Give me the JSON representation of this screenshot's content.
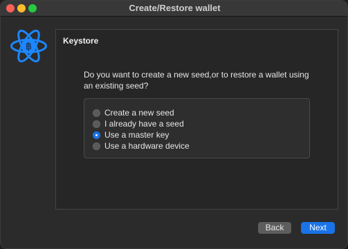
{
  "window": {
    "title": "Create/Restore wallet"
  },
  "colors": {
    "close": "#ff5f57",
    "minimize": "#febc2e",
    "zoom": "#28c840",
    "logo": "#1c87ff",
    "accent": "#1a73e8"
  },
  "logo": {
    "icon": "electrum-bitcoin-logo"
  },
  "panel": {
    "heading": "Keystore",
    "question": "Do you want to create a new seed,or to restore a wallet using an existing seed?",
    "options": [
      {
        "label": "Create a new seed",
        "checked": false
      },
      {
        "label": "I already have a seed",
        "checked": false
      },
      {
        "label": "Use a master key",
        "checked": true
      },
      {
        "label": "Use a hardware device",
        "checked": false
      }
    ]
  },
  "buttons": {
    "back": "Back",
    "next": "Next"
  }
}
